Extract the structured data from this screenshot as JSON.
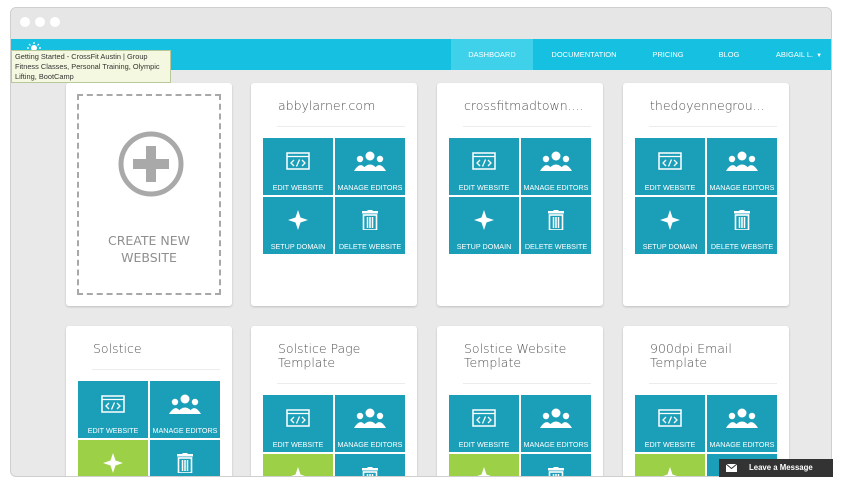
{
  "tooltip": "Getting Started - CrossFit Austin | Group Fitness Classes, Personal Training, Olympic Lifting, BootCamp",
  "nav": {
    "items": [
      "DASHBOARD",
      "DOCUMENTATION",
      "PRICING",
      "BLOG"
    ],
    "active": "DASHBOARD",
    "user": "ABIGAIL L."
  },
  "create_card": {
    "label": "CREATE NEW WEBSITE"
  },
  "cards": [
    {
      "title": "abbylarner.com"
    },
    {
      "title": "crossfitmadtown...."
    },
    {
      "title": "thedoyennegrou..."
    },
    {
      "title": "Solstice"
    },
    {
      "title": "Solstice Page Template"
    },
    {
      "title": "Solstice Website Template"
    },
    {
      "title": "900dpi Email Template"
    }
  ],
  "actions": {
    "edit": "EDIT WEBSITE",
    "manage": "MANAGE EDITORS",
    "domain": "SETUP DOMAIN",
    "delete": "DELETE WEBSITE"
  },
  "chat": {
    "label": "Leave a Message"
  },
  "colors": {
    "navbar": "#16c0e0",
    "nav_active": "#3fd0ea",
    "tile": "#1b9fb8",
    "tile_green": "#9cd047",
    "background": "#e9e9e9"
  },
  "icons": {
    "edit": "code-window-icon",
    "manage": "users-icon",
    "domain": "sparkle-icon",
    "delete": "trash-icon",
    "create": "plus-circle-icon",
    "chat": "envelope-icon"
  }
}
